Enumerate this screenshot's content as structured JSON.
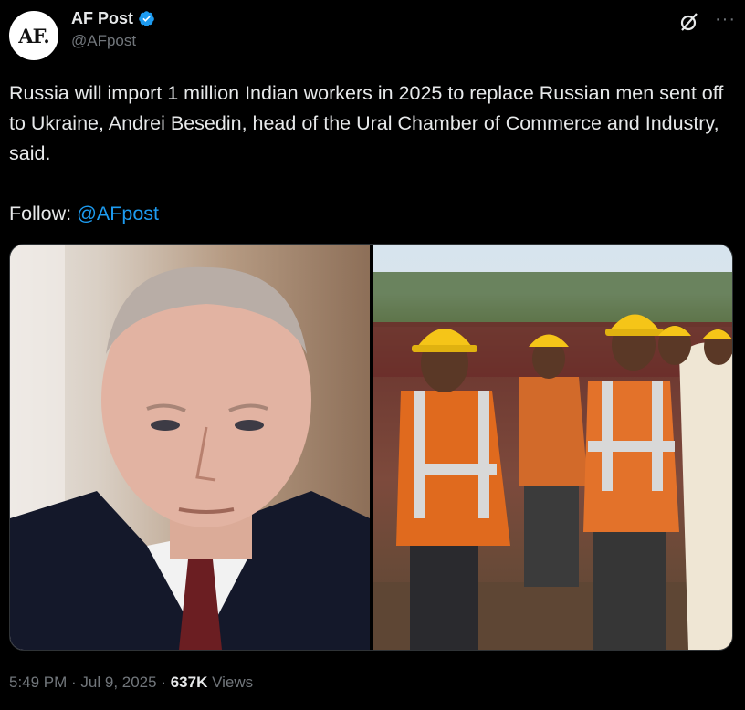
{
  "tweet": {
    "author": {
      "avatar_text": "AF.",
      "display_name": "AF Post",
      "handle": "@AFpost",
      "verified_icon": "verified-badge-icon"
    },
    "actions": {
      "grok_icon": "grok-icon",
      "more_label": "···"
    },
    "text": {
      "main": "Russia will import 1 million Indian workers in 2025 to replace Russian men sent off to Ukraine, Andrei Besedin, head of the Ural Chamber of Commerce and Industry, said.",
      "follow_label": "Follow: ",
      "follow_mention": "@AFpost"
    },
    "media": [
      {
        "type": "photo",
        "subject": "man-in-suit-portrait"
      },
      {
        "type": "photo",
        "subject": "construction-workers-hardhats"
      }
    ],
    "meta": {
      "time": "5:49 PM",
      "sep1": " · ",
      "date": "Jul 9, 2025",
      "sep2": " · ",
      "views_count": "637K",
      "views_label": " Views"
    },
    "colors": {
      "background": "#000000",
      "text": "#e7e9ea",
      "secondary": "#71767b",
      "accent": "#1d9bf0"
    }
  }
}
